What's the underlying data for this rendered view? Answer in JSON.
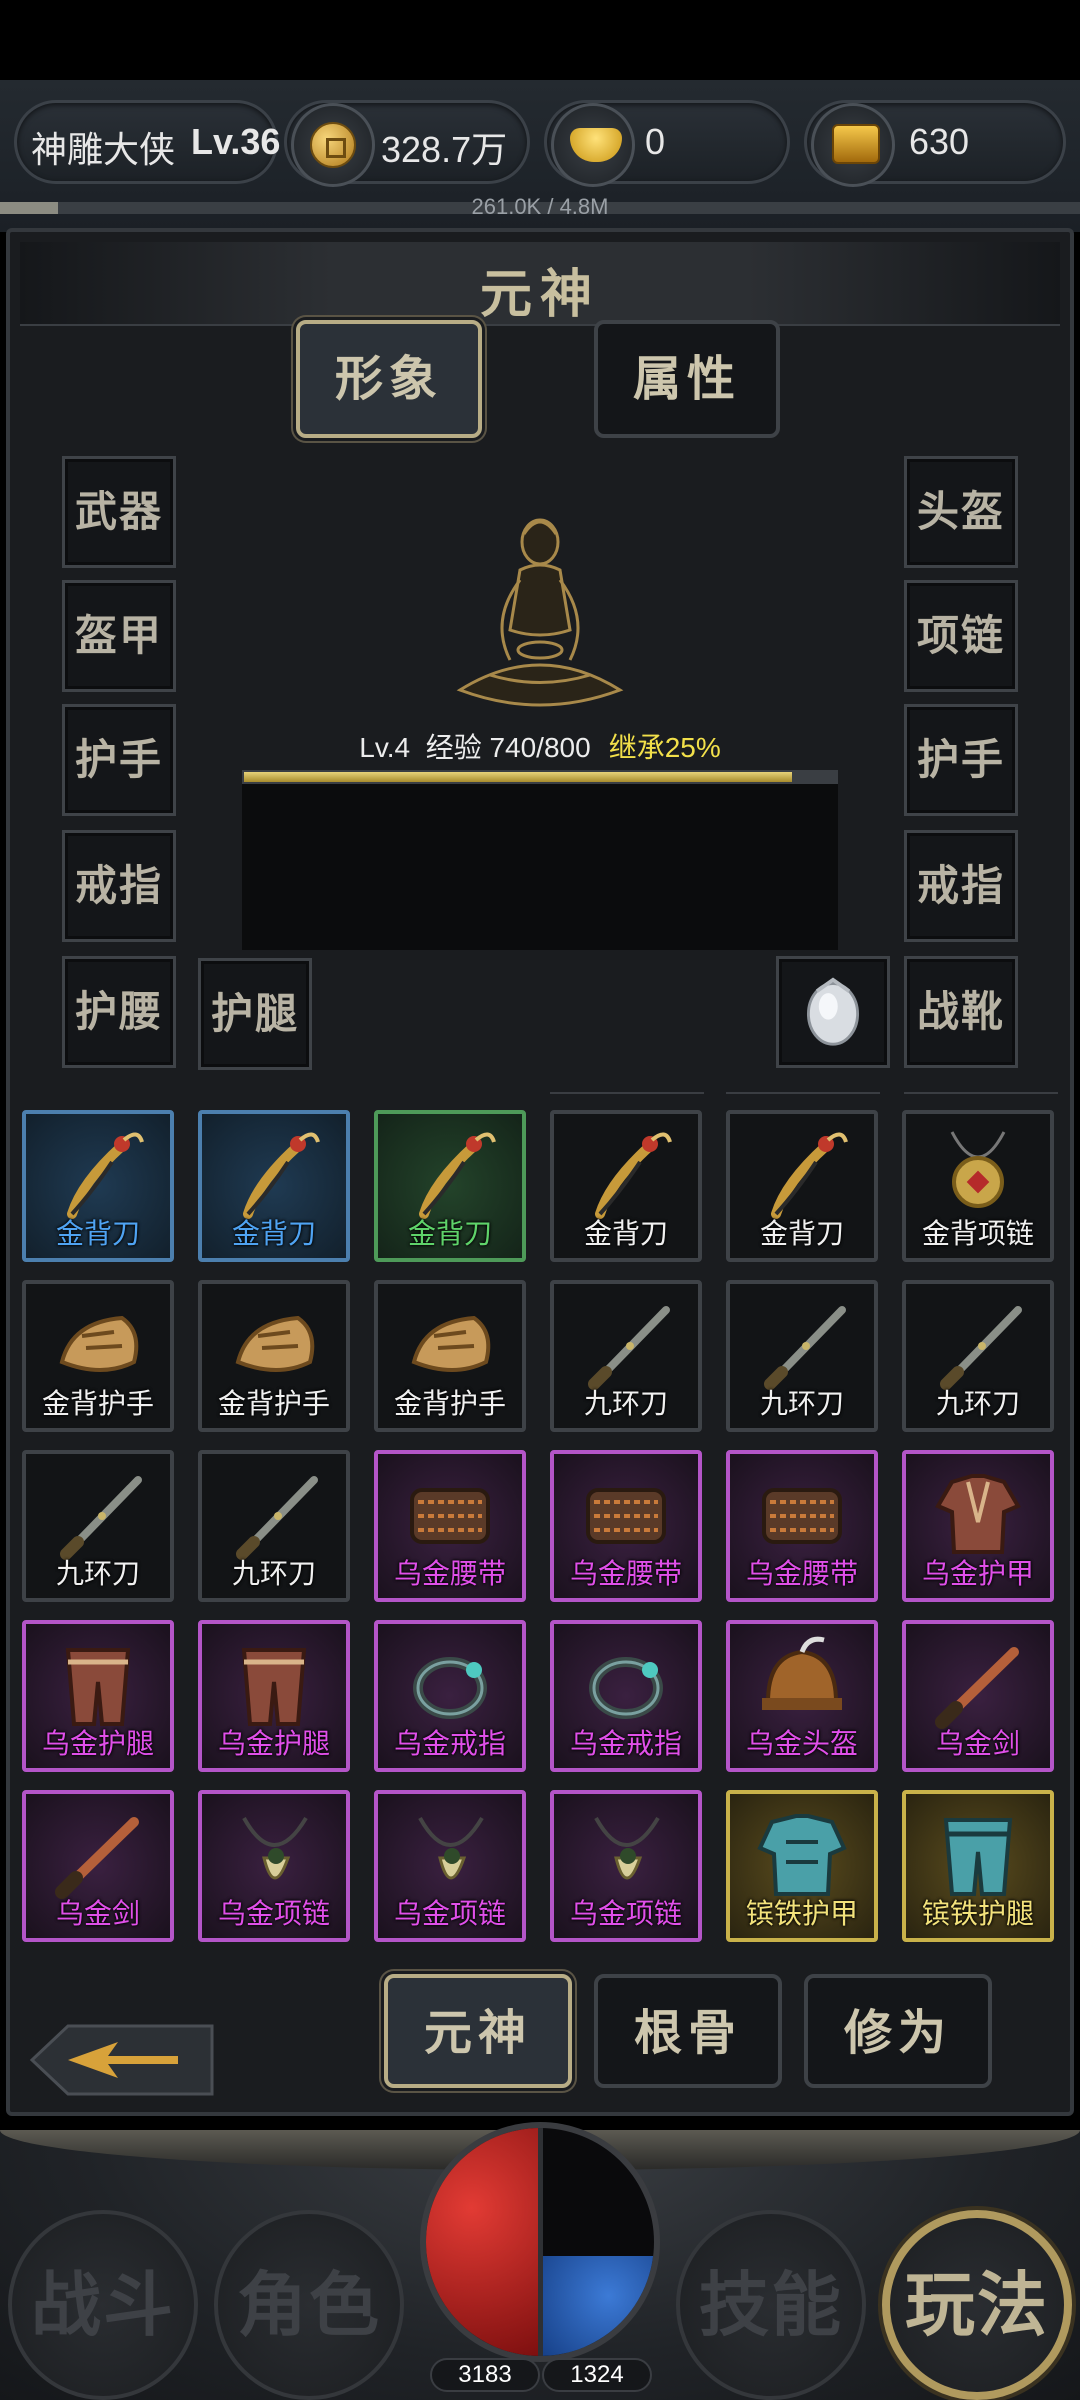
{
  "topbar": {
    "player_name": "神雕大侠",
    "player_level": "Lv.36",
    "coins": "328.7万",
    "gold_ingots": "0",
    "treasure": "630",
    "xp_text": "261.0K / 4.8M",
    "xp_progress": 0.054
  },
  "panel": {
    "title": "元神",
    "tabs": [
      {
        "label": "形象",
        "active": true
      },
      {
        "label": "属性",
        "active": false
      }
    ],
    "left_slots": [
      "武器",
      "盔甲",
      "护手",
      "戒指",
      "护腰"
    ],
    "extra_slot": "护腿",
    "right_slots": [
      "头盔",
      "项链",
      "护手",
      "戒指",
      "战靴"
    ],
    "level_text": "Lv.4",
    "exp_text": "经验 740/800",
    "exp_progress": 0.925,
    "inherit_text": "继承25%"
  },
  "inventory": [
    {
      "name": "金背刀",
      "quality": "blue",
      "icon": "saber-icon"
    },
    {
      "name": "金背刀",
      "quality": "blue",
      "icon": "saber-icon"
    },
    {
      "name": "金背刀",
      "quality": "green",
      "icon": "saber-icon"
    },
    {
      "name": "金背刀",
      "quality": "white",
      "icon": "saber-icon"
    },
    {
      "name": "金背刀",
      "quality": "white",
      "icon": "saber-icon"
    },
    {
      "name": "金背项链",
      "quality": "white",
      "icon": "necklace-icon"
    },
    {
      "name": "金背护手",
      "quality": "white",
      "icon": "gauntlet-icon"
    },
    {
      "name": "金背护手",
      "quality": "white",
      "icon": "gauntlet-icon"
    },
    {
      "name": "金背护手",
      "quality": "white",
      "icon": "gauntlet-icon"
    },
    {
      "name": "九环刀",
      "quality": "white",
      "icon": "blade-icon"
    },
    {
      "name": "九环刀",
      "quality": "white",
      "icon": "blade-icon"
    },
    {
      "name": "九环刀",
      "quality": "white",
      "icon": "blade-icon"
    },
    {
      "name": "九环刀",
      "quality": "white",
      "icon": "blade-icon"
    },
    {
      "name": "九环刀",
      "quality": "white",
      "icon": "blade-icon"
    },
    {
      "name": "乌金腰带",
      "quality": "purple",
      "icon": "belt-icon"
    },
    {
      "name": "乌金腰带",
      "quality": "purple",
      "icon": "belt-icon"
    },
    {
      "name": "乌金腰带",
      "quality": "purple",
      "icon": "belt-icon"
    },
    {
      "name": "乌金护甲",
      "quality": "purple",
      "icon": "armor-icon"
    },
    {
      "name": "乌金护腿",
      "quality": "purple",
      "icon": "leggings-icon"
    },
    {
      "name": "乌金护腿",
      "quality": "purple",
      "icon": "leggings-icon"
    },
    {
      "name": "乌金戒指",
      "quality": "purple",
      "icon": "ring-icon"
    },
    {
      "name": "乌金戒指",
      "quality": "purple",
      "icon": "ring-icon"
    },
    {
      "name": "乌金头盔",
      "quality": "purple",
      "icon": "helmet-icon"
    },
    {
      "name": "乌金剑",
      "quality": "purple",
      "icon": "sword-icon"
    },
    {
      "name": "乌金剑",
      "quality": "purple",
      "icon": "sword-icon"
    },
    {
      "name": "乌金项链",
      "quality": "purple",
      "icon": "fang-necklace-icon"
    },
    {
      "name": "乌金项链",
      "quality": "purple",
      "icon": "fang-necklace-icon"
    },
    {
      "name": "乌金项链",
      "quality": "purple",
      "icon": "fang-necklace-icon"
    },
    {
      "name": "镔铁护甲",
      "quality": "gold",
      "icon": "steel-armor-icon"
    },
    {
      "name": "镔铁护腿",
      "quality": "gold",
      "icon": "steel-leggings-icon"
    }
  ],
  "subtabs": [
    {
      "label": "元神",
      "active": true
    },
    {
      "label": "根骨",
      "active": false
    },
    {
      "label": "修为",
      "active": false
    }
  ],
  "bottomnav": {
    "items": [
      {
        "label": "战斗",
        "active": false
      },
      {
        "label": "角色",
        "active": false
      },
      {
        "label": "技能",
        "active": false
      },
      {
        "label": "玩法",
        "active": true
      }
    ],
    "hp": "3183",
    "mp": "1324",
    "hp_level": 1.0,
    "mp_level": 0.44
  },
  "colors": {
    "blue": "#4fa3f2",
    "green": "#5fd36a",
    "purple": "#e04fe9",
    "gold": "#f3e27b",
    "accent": "#b8ad86"
  }
}
